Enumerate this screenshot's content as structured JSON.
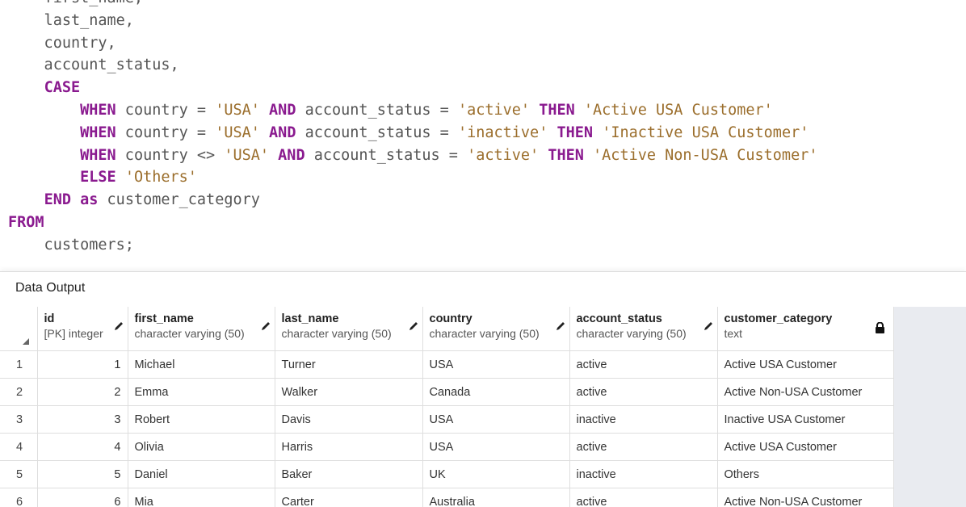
{
  "editor": {
    "lines": [
      [
        {
          "t": "    first_name,",
          "c": "plain"
        }
      ],
      [
        {
          "t": "    last_name,",
          "c": "plain"
        }
      ],
      [
        {
          "t": "    country,",
          "c": "plain"
        }
      ],
      [
        {
          "t": "    account_status,",
          "c": "plain"
        }
      ],
      [
        {
          "t": "    ",
          "c": "plain"
        },
        {
          "t": "CASE",
          "c": "kw"
        }
      ],
      [
        {
          "t": "        ",
          "c": "plain"
        },
        {
          "t": "WHEN",
          "c": "kw"
        },
        {
          "t": " country = ",
          "c": "plain"
        },
        {
          "t": "'USA'",
          "c": "str"
        },
        {
          "t": " ",
          "c": "plain"
        },
        {
          "t": "AND",
          "c": "kw"
        },
        {
          "t": " account_status = ",
          "c": "plain"
        },
        {
          "t": "'active'",
          "c": "str"
        },
        {
          "t": " ",
          "c": "plain"
        },
        {
          "t": "THEN",
          "c": "kw"
        },
        {
          "t": " ",
          "c": "plain"
        },
        {
          "t": "'Active USA Customer'",
          "c": "str"
        }
      ],
      [
        {
          "t": "        ",
          "c": "plain"
        },
        {
          "t": "WHEN",
          "c": "kw"
        },
        {
          "t": " country = ",
          "c": "plain"
        },
        {
          "t": "'USA'",
          "c": "str"
        },
        {
          "t": " ",
          "c": "plain"
        },
        {
          "t": "AND",
          "c": "kw"
        },
        {
          "t": " account_status = ",
          "c": "plain"
        },
        {
          "t": "'inactive'",
          "c": "str"
        },
        {
          "t": " ",
          "c": "plain"
        },
        {
          "t": "THEN",
          "c": "kw"
        },
        {
          "t": " ",
          "c": "plain"
        },
        {
          "t": "'Inactive USA Customer'",
          "c": "str"
        }
      ],
      [
        {
          "t": "        ",
          "c": "plain"
        },
        {
          "t": "WHEN",
          "c": "kw"
        },
        {
          "t": " country <> ",
          "c": "plain"
        },
        {
          "t": "'USA'",
          "c": "str"
        },
        {
          "t": " ",
          "c": "plain"
        },
        {
          "t": "AND",
          "c": "kw"
        },
        {
          "t": " account_status = ",
          "c": "plain"
        },
        {
          "t": "'active'",
          "c": "str"
        },
        {
          "t": " ",
          "c": "plain"
        },
        {
          "t": "THEN",
          "c": "kw"
        },
        {
          "t": " ",
          "c": "plain"
        },
        {
          "t": "'Active Non-USA Customer'",
          "c": "str"
        }
      ],
      [
        {
          "t": "        ",
          "c": "plain"
        },
        {
          "t": "ELSE",
          "c": "kw"
        },
        {
          "t": " ",
          "c": "plain"
        },
        {
          "t": "'Others'",
          "c": "str"
        }
      ],
      [
        {
          "t": "    ",
          "c": "plain"
        },
        {
          "t": "END",
          "c": "kw"
        },
        {
          "t": " ",
          "c": "plain"
        },
        {
          "t": "as",
          "c": "kw"
        },
        {
          "t": " customer_category",
          "c": "plain"
        }
      ],
      [
        {
          "t": "FROM",
          "c": "kw"
        }
      ],
      [
        {
          "t": "    customers;",
          "c": "plain"
        }
      ]
    ],
    "colors": {
      "keyword": "#8a1a8f",
      "string": "#9b6e2c",
      "text": "#555555"
    }
  },
  "output": {
    "title": "Data Output",
    "columns": [
      {
        "name": "id",
        "type": "[PK] integer",
        "editable": true
      },
      {
        "name": "first_name",
        "type": "character varying (50)",
        "editable": true
      },
      {
        "name": "last_name",
        "type": "character varying (50)",
        "editable": true
      },
      {
        "name": "country",
        "type": "character varying (50)",
        "editable": true
      },
      {
        "name": "account_status",
        "type": "character varying (50)",
        "editable": true
      },
      {
        "name": "customer_category",
        "type": "text",
        "editable": false
      }
    ],
    "rows": [
      {
        "num": "1",
        "cells": [
          "1",
          "Michael",
          "Turner",
          "USA",
          "active",
          "Active USA Customer"
        ]
      },
      {
        "num": "2",
        "cells": [
          "2",
          "Emma",
          "Walker",
          "Canada",
          "active",
          "Active Non-USA Customer"
        ]
      },
      {
        "num": "3",
        "cells": [
          "3",
          "Robert",
          "Davis",
          "USA",
          "inactive",
          "Inactive USA Customer"
        ]
      },
      {
        "num": "4",
        "cells": [
          "4",
          "Olivia",
          "Harris",
          "USA",
          "active",
          "Active USA Customer"
        ]
      },
      {
        "num": "5",
        "cells": [
          "5",
          "Daniel",
          "Baker",
          "UK",
          "inactive",
          "Others"
        ]
      },
      {
        "num": "6",
        "cells": [
          "6",
          "Mia",
          "Carter",
          "Australia",
          "active",
          "Active Non-USA Customer"
        ]
      }
    ],
    "icons": {
      "editable_column": "pencil-icon",
      "readonly_column": "lock-icon",
      "sort": "sort-icon"
    }
  }
}
